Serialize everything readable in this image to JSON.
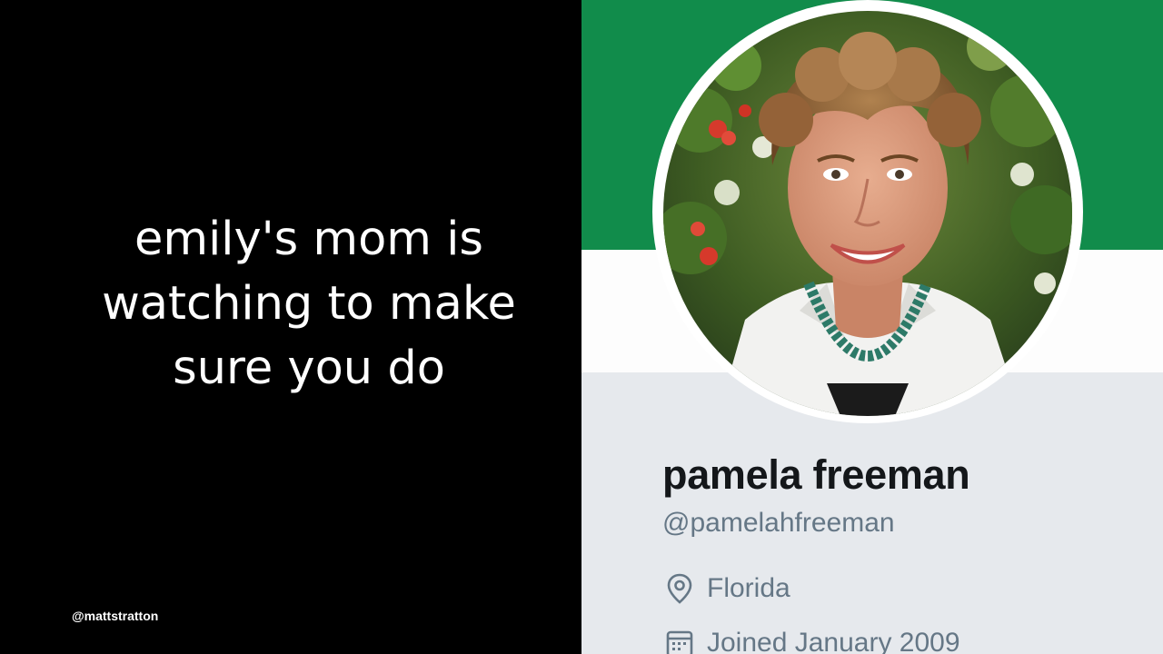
{
  "slide": {
    "text_lines": [
      "emily's mom is",
      "watching to make",
      "sure you do"
    ],
    "footer_handle": "@mattstratton"
  },
  "profile": {
    "name": "pamela freeman",
    "handle": "@pamelahfreeman",
    "location": "Florida",
    "joined": "Joined January 2009",
    "avatar_alt": "profile photo",
    "location_icon": "location-pin-icon",
    "joined_icon": "calendar-icon"
  },
  "colors": {
    "banner": "#118c4b",
    "background_left": "#000000",
    "profile_bg": "#e6e9ed",
    "secondary_text": "#657786",
    "primary_text": "#14171a"
  }
}
